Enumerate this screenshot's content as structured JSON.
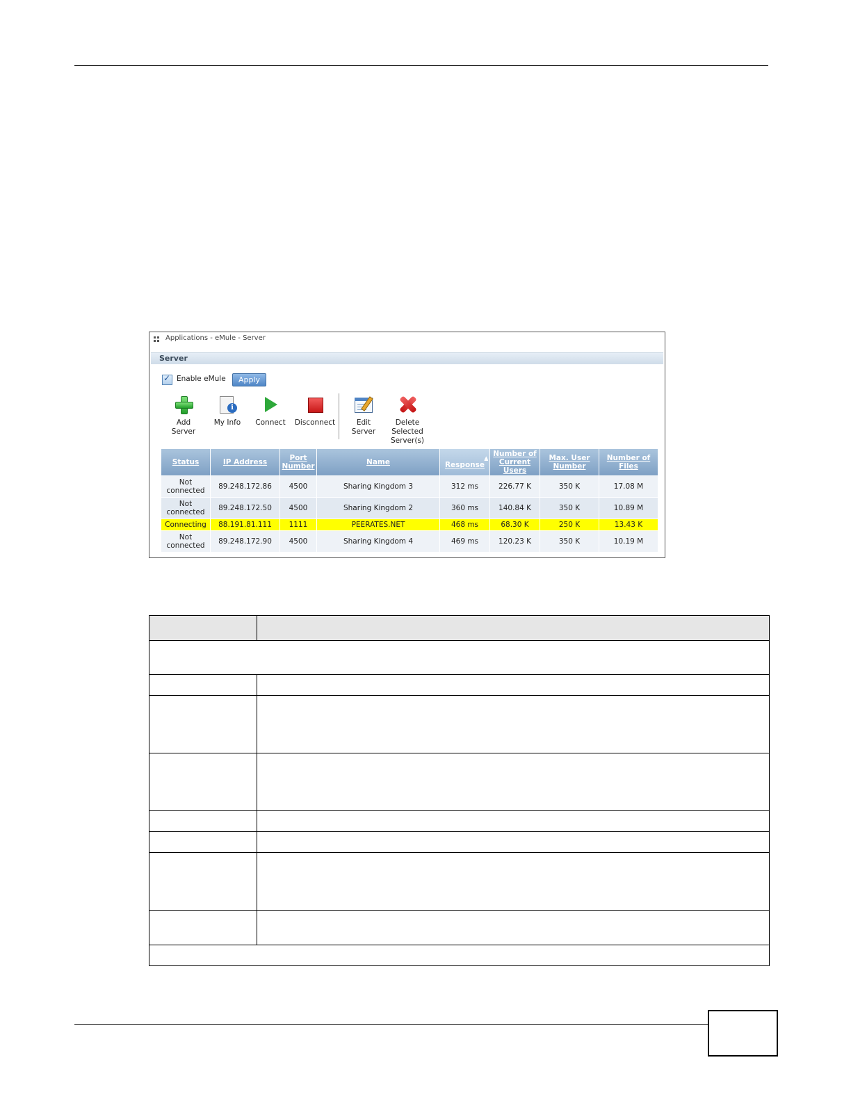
{
  "screenshot": {
    "breadcrumb": "Applications - eMule - Server",
    "panel_title": "Server",
    "enable_label": "Enable eMule",
    "apply_label": "Apply",
    "toolbar": [
      {
        "label": "Add\nServer",
        "icon": "add-icon"
      },
      {
        "label": "My Info",
        "icon": "info-icon"
      },
      {
        "label": "Connect",
        "icon": "play-icon"
      },
      {
        "label": "Disconnect",
        "icon": "stop-icon"
      },
      {
        "label": "Edit\nServer",
        "icon": "edit-icon"
      },
      {
        "label": "Delete\nSelected\nServer(s)",
        "icon": "delete-icon"
      }
    ],
    "columns": [
      "Status",
      "IP Address",
      "Port Number",
      "Name",
      "Response",
      "Number of Current Users",
      "Max. User Number",
      "Number of Files"
    ],
    "rows": [
      [
        "Not connected",
        "89.248.172.86",
        "4500",
        "Sharing Kingdom 3",
        "312 ms",
        "226.77 K",
        "350 K",
        "17.08 M"
      ],
      [
        "Not connected",
        "89.248.172.50",
        "4500",
        "Sharing Kingdom 2",
        "360 ms",
        "140.84 K",
        "350 K",
        "10.89 M"
      ],
      [
        "Connecting",
        "88.191.81.111",
        "1111",
        "PEERATES.NET",
        "468 ms",
        "68.30 K",
        "250 K",
        "13.43 K"
      ],
      [
        "Not connected",
        "89.248.172.90",
        "4500",
        "Sharing Kingdom 4",
        "469 ms",
        "120.23 K",
        "350 K",
        "10.19 M"
      ]
    ],
    "highlight_color": "#ffff00",
    "header_color": "#8eacce"
  }
}
